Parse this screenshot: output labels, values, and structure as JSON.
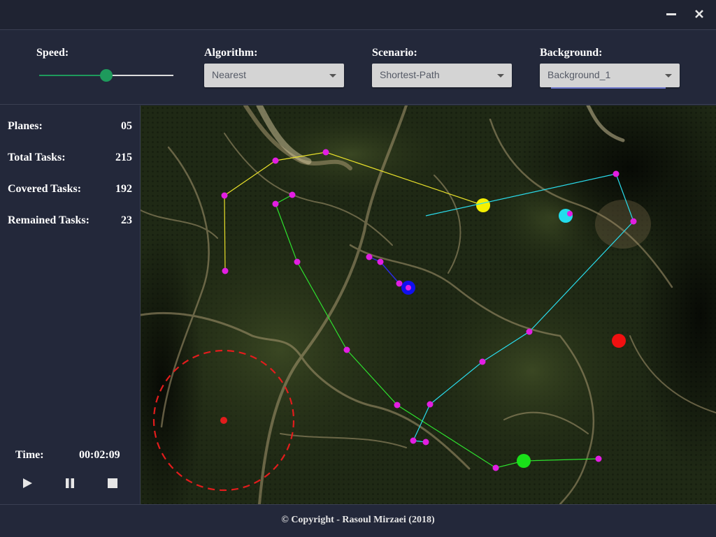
{
  "window": {
    "minimize_icon": "minimize-icon",
    "close_icon": "close-icon"
  },
  "controls": {
    "speed": {
      "label": "Speed:",
      "value_fraction": 0.5,
      "accent": "#1e9a5c"
    },
    "algorithm": {
      "label": "Algorithm:",
      "selected": "Nearest"
    },
    "scenario": {
      "label": "Scenario:",
      "selected": "Shortest-Path"
    },
    "background": {
      "label": "Background:",
      "selected": "Background_1"
    }
  },
  "stats": {
    "planes": {
      "label": "Planes:",
      "value": "05"
    },
    "total_tasks": {
      "label": "Total Tasks:",
      "value": "215"
    },
    "covered_tasks": {
      "label": "Covered Tasks:",
      "value": "192"
    },
    "remained_tasks": {
      "label": "Remained Tasks:",
      "value": "23"
    }
  },
  "time": {
    "label": "Time:",
    "value": "00:02:09"
  },
  "playback": {
    "play_icon": "play-icon",
    "pause_icon": "pause-icon",
    "stop_icon": "stop-icon"
  },
  "map": {
    "task_color": "#e21ee2",
    "planes": [
      {
        "name": "yellow",
        "color": "#f5f000"
      },
      {
        "name": "green",
        "color": "#19e019"
      },
      {
        "name": "blue",
        "color": "#1010ee"
      },
      {
        "name": "cyan",
        "color": "#22dcec"
      },
      {
        "name": "red",
        "color": "#f01010"
      }
    ],
    "zone_color": "#e21c1c"
  },
  "footer": {
    "copyright": "© Copyright - Rasoul Mirzaei (2018)"
  }
}
